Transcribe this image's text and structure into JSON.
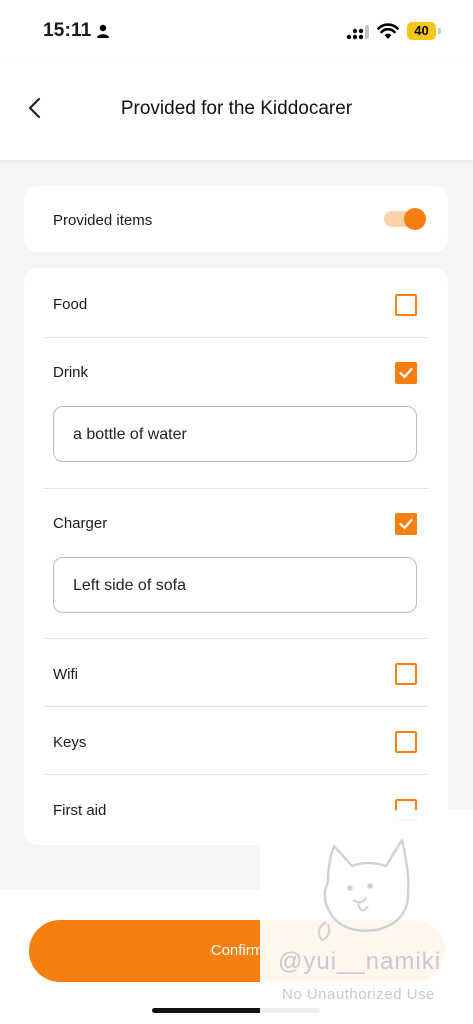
{
  "status_bar": {
    "time": "15:11",
    "battery": "40"
  },
  "header": {
    "title": "Provided for the Kiddocarer"
  },
  "provided": {
    "label": "Provided items",
    "enabled": true
  },
  "items": [
    {
      "label": "Food",
      "checked": false
    },
    {
      "label": "Drink",
      "checked": true,
      "value": "a bottle of water"
    },
    {
      "label": "Charger",
      "checked": true,
      "value": "Left side of sofa"
    },
    {
      "label": "Wifi",
      "checked": false
    },
    {
      "label": "Keys",
      "checked": false
    },
    {
      "label": "First aid",
      "checked": false
    }
  ],
  "footer": {
    "confirm_label": "Confirm"
  },
  "watermark": {
    "handle": "@yui__namiki",
    "notice": "No Unauthorized Use"
  },
  "colors": {
    "accent": "#f77f0f",
    "accent_light": "#fcd2a8"
  }
}
